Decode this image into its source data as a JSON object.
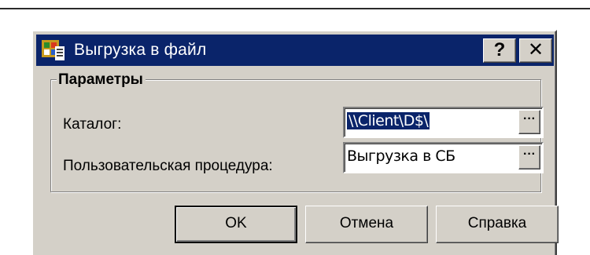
{
  "window": {
    "title": "Выгрузка в файл",
    "help_glyph": "?",
    "close_glyph": "✕"
  },
  "group": {
    "legend": "Параметры"
  },
  "fields": {
    "catalog": {
      "label": "Каталог:",
      "value": "\\\\Client\\D$\\"
    },
    "procedure": {
      "label": "Пользовательская процедура:",
      "value": "Выгрузка в СБ"
    },
    "browse_glyph": "···"
  },
  "buttons": {
    "ok": "OK",
    "cancel": "Отмена",
    "help": "Справка"
  },
  "colors": {
    "titlebar": "#0a246a",
    "face": "#d4d0c8",
    "selection": "#0a246a"
  },
  "icons": {
    "app": "app-icon",
    "help": "question-icon",
    "close": "close-icon",
    "browse": "ellipsis-icon"
  }
}
